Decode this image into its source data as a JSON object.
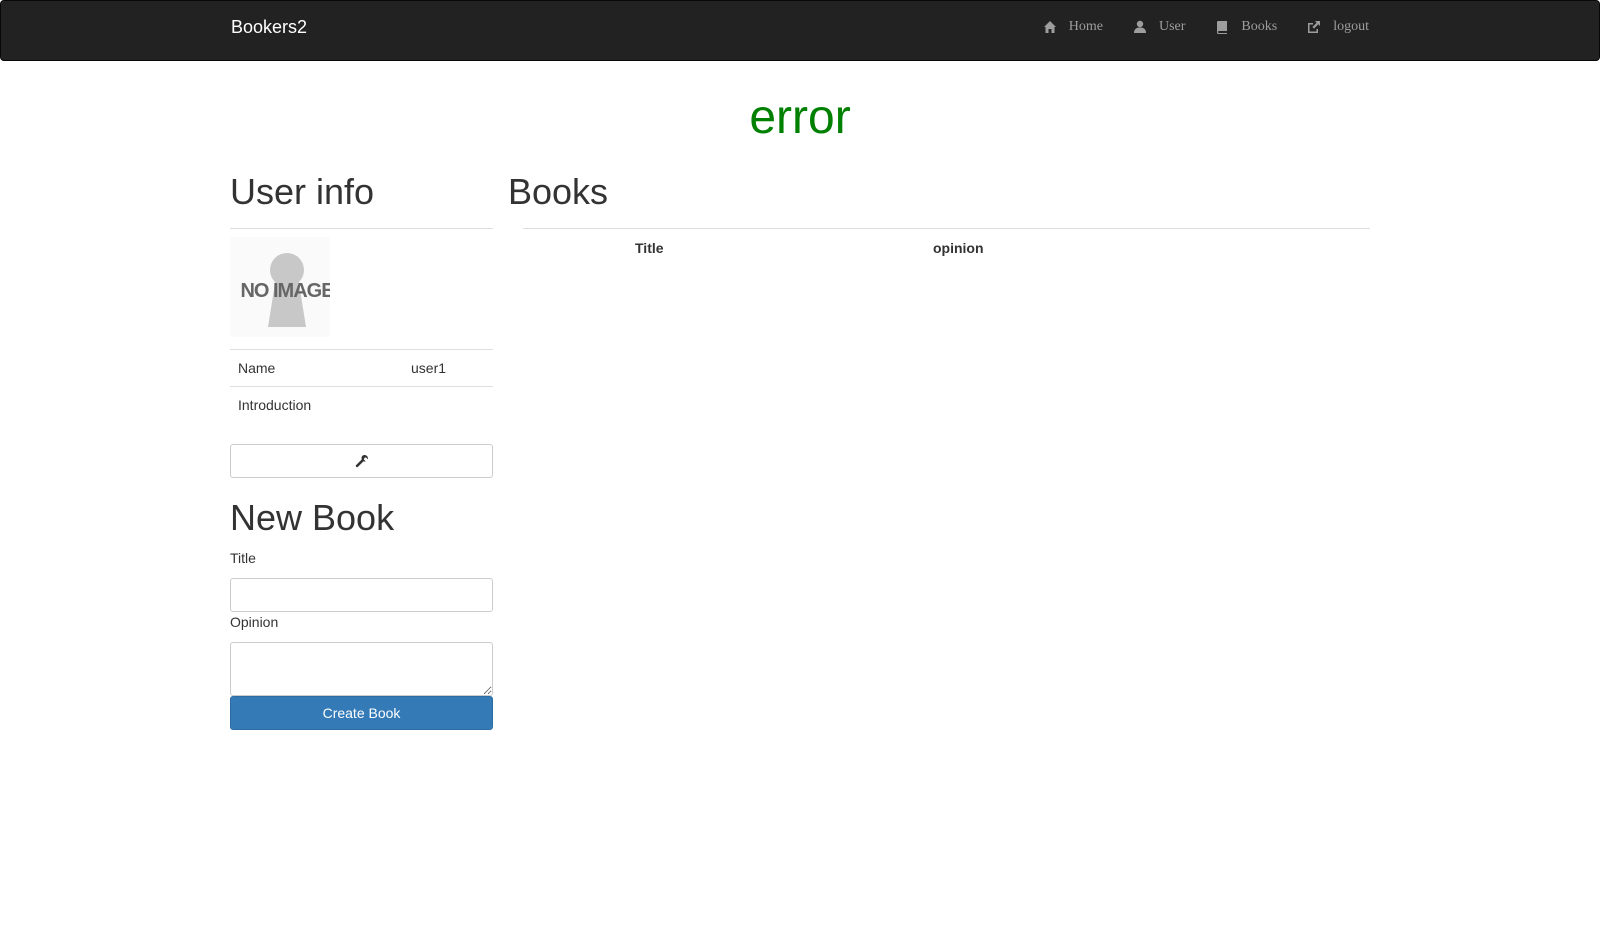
{
  "navbar": {
    "brand": "Bookers2",
    "links": [
      {
        "label": "Home",
        "icon": "home-icon"
      },
      {
        "label": "User",
        "icon": "user-icon"
      },
      {
        "label": "Books",
        "icon": "book-icon"
      },
      {
        "label": "logout",
        "icon": "logout-icon"
      }
    ]
  },
  "flash": {
    "message": "error",
    "color": "#008000"
  },
  "user_info": {
    "heading": "User info",
    "image_alt": "NO IMAGE",
    "rows": [
      {
        "label": "Name",
        "value": "user1"
      },
      {
        "label": "Introduction",
        "value": ""
      }
    ],
    "edit_icon": "wrench-icon"
  },
  "new_book": {
    "heading": "New Book",
    "title_label": "Title",
    "title_value": "",
    "opinion_label": "Opinion",
    "opinion_value": "",
    "submit_label": "Create Book",
    "submit_color": "#337ab7"
  },
  "books": {
    "heading": "Books",
    "columns": [
      "",
      "Title",
      "opinion"
    ]
  }
}
